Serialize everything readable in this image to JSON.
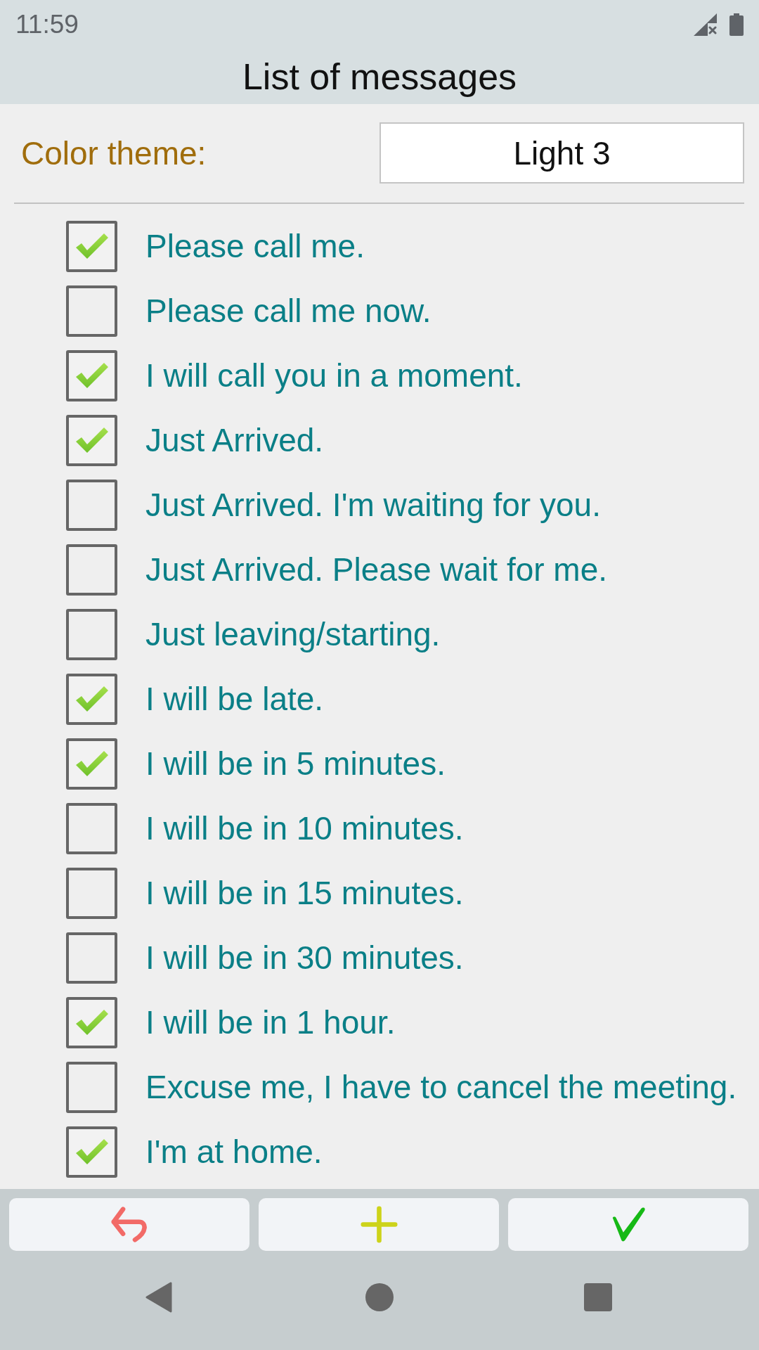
{
  "status_bar": {
    "time": "11:59"
  },
  "title": "List of messages",
  "theme": {
    "label": "Color theme:",
    "value": "Light 3"
  },
  "messages": [
    {
      "text": "Please call me.",
      "checked": true
    },
    {
      "text": "Please call me now.",
      "checked": false
    },
    {
      "text": "I will call you in a moment.",
      "checked": true
    },
    {
      "text": "Just Arrived.",
      "checked": true
    },
    {
      "text": "Just Arrived. I'm waiting for you.",
      "checked": false
    },
    {
      "text": "Just Arrived. Please wait for me.",
      "checked": false
    },
    {
      "text": "Just leaving/starting.",
      "checked": false
    },
    {
      "text": "I will be late.",
      "checked": true
    },
    {
      "text": "I will be in 5 minutes.",
      "checked": true
    },
    {
      "text": "I will be in 10 minutes.",
      "checked": false
    },
    {
      "text": "I will be in 15 minutes.",
      "checked": false
    },
    {
      "text": "I will be in 30 minutes.",
      "checked": false
    },
    {
      "text": "I will be in 1 hour.",
      "checked": true
    },
    {
      "text": "Excuse me, I have to cancel the meeting.",
      "checked": false
    },
    {
      "text": "I'm at home.",
      "checked": true
    }
  ],
  "toolbar": {
    "buttons": [
      {
        "kind": "undo"
      },
      {
        "kind": "add"
      },
      {
        "kind": "confirm"
      }
    ]
  }
}
